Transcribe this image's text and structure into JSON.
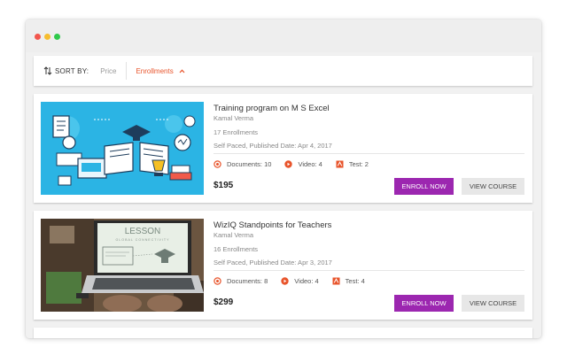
{
  "sort": {
    "label": "SORT BY:",
    "options": [
      "Price",
      "Enrollments"
    ],
    "active": "Enrollments"
  },
  "courses": [
    {
      "title": "Training program on M S Excel",
      "author": "Kamal Verma",
      "enrollments": "17 Enrollments",
      "meta": "Self Paced, Published Date: Apr 4, 2017",
      "documents": "Documents: 10",
      "video": "Video: 4",
      "test": "Test: 2",
      "price": "$195",
      "enroll_label": "ENROLL NOW",
      "view_label": "VIEW COURSE"
    },
    {
      "title": "WizIQ Standpoints for Teachers",
      "author": "Kamal Verma",
      "enrollments": "16 Enrollments",
      "meta": "Self Paced, Published Date: Apr 3, 2017",
      "documents": "Documents: 8",
      "video": "Video: 4",
      "test": "Test: 4",
      "price": "$299",
      "enroll_label": "ENROLL NOW",
      "view_label": "VIEW COURSE",
      "thumb_text": {
        "heading": "LESSON",
        "sub": "GLOBAL CONNECTIVITY"
      }
    }
  ],
  "colors": {
    "accent": "#e8542b",
    "enroll_button": "#9c27b0",
    "view_button": "#e7e7e7",
    "window_red": "#f2564d",
    "window_yellow": "#f6bd2f",
    "window_green": "#2fc94b"
  },
  "icons": {
    "sort": "sort-arrows-icon",
    "sort_direction": "chevron-up-icon",
    "documents": "document-icon",
    "video": "play-icon",
    "test": "test-icon"
  }
}
